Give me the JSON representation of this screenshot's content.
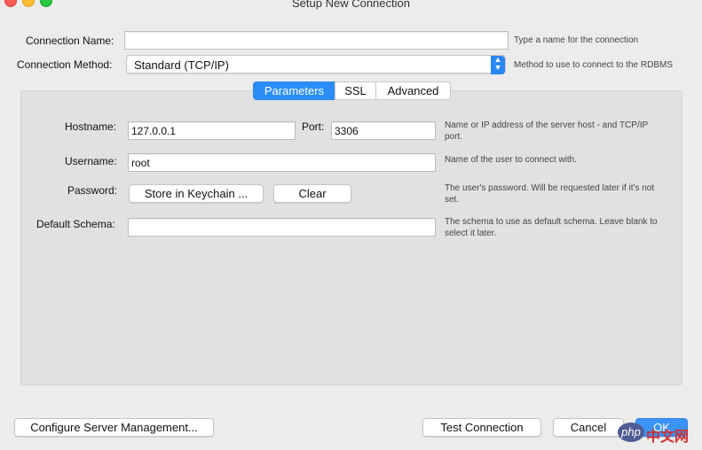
{
  "window": {
    "title": "Setup New Connection"
  },
  "connection_name": {
    "label": "Connection Name:",
    "value": "",
    "help": "Type a name for the connection"
  },
  "connection_method": {
    "label": "Connection Method:",
    "value": "Standard (TCP/IP)",
    "help": "Method to use to connect to the RDBMS"
  },
  "tabs": [
    {
      "label": "Parameters",
      "selected": true
    },
    {
      "label": "SSL",
      "selected": false
    },
    {
      "label": "Advanced",
      "selected": false
    }
  ],
  "hostname": {
    "label": "Hostname:",
    "value": "127.0.0.1"
  },
  "port": {
    "label": "Port:",
    "value": "3306"
  },
  "host_help": "Name or IP address of the server host - and TCP/IP port.",
  "username": {
    "label": "Username:",
    "value": "root",
    "help": "Name of the user to connect with."
  },
  "password": {
    "label": "Password:",
    "store_label": "Store in Keychain ...",
    "clear_label": "Clear",
    "help": "The user's password. Will be requested later if it's not set."
  },
  "default_schema": {
    "label": "Default Schema:",
    "value": "",
    "help": "The schema to use as default schema. Leave blank to select it later."
  },
  "footer": {
    "configure_label": "Configure Server Management...",
    "test_label": "Test Connection",
    "cancel_label": "Cancel",
    "ok_label": "OK"
  },
  "watermark": {
    "text_php": "php",
    "text_cn": "中文网"
  },
  "colors": {
    "accent": "#2b8ef8",
    "panel": "#e1e1e1",
    "window": "#ececec"
  }
}
